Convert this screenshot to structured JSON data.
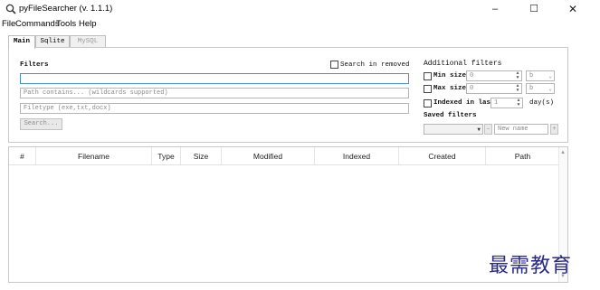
{
  "window": {
    "title": "pyFileSearcher (v. 1.1.1)",
    "icon": "magnifier-icon",
    "controls": {
      "minimize": "–",
      "maximize": "☐",
      "close": "✕"
    }
  },
  "menu": [
    "File",
    "Commands",
    "Tools",
    "Help"
  ],
  "tabs": [
    {
      "label": "Main",
      "state": "active"
    },
    {
      "label": "Sqlite",
      "state": "normal"
    },
    {
      "label": "MySQL",
      "state": "disabled"
    }
  ],
  "filters": {
    "label": "Filters",
    "search_in_removed_label": "Search in removed",
    "search_value": "",
    "path_placeholder": "Path contains... (wildcards supported)",
    "filetype_placeholder": "Filetype (exe,txt,docx)",
    "search_button": "Search..."
  },
  "additional": {
    "label": "Additional filters",
    "min_size_label": "Min size:",
    "min_size_value": "0",
    "min_size_unit": "b",
    "max_size_label": "Max size:",
    "max_size_value": "0",
    "max_size_unit": "b",
    "indexed_label": "Indexed in last",
    "indexed_value": "1",
    "indexed_unit": "day(s)",
    "saved_label": "Saved filters",
    "saved_selected": "",
    "remove_label": "–",
    "new_name_placeholder": "New name",
    "add_label": "+"
  },
  "table": {
    "columns": [
      "#",
      "Filename",
      "Type",
      "Size",
      "Modified",
      "Indexed",
      "Created",
      "Path"
    ],
    "rows": []
  },
  "watermark": "最需教育"
}
